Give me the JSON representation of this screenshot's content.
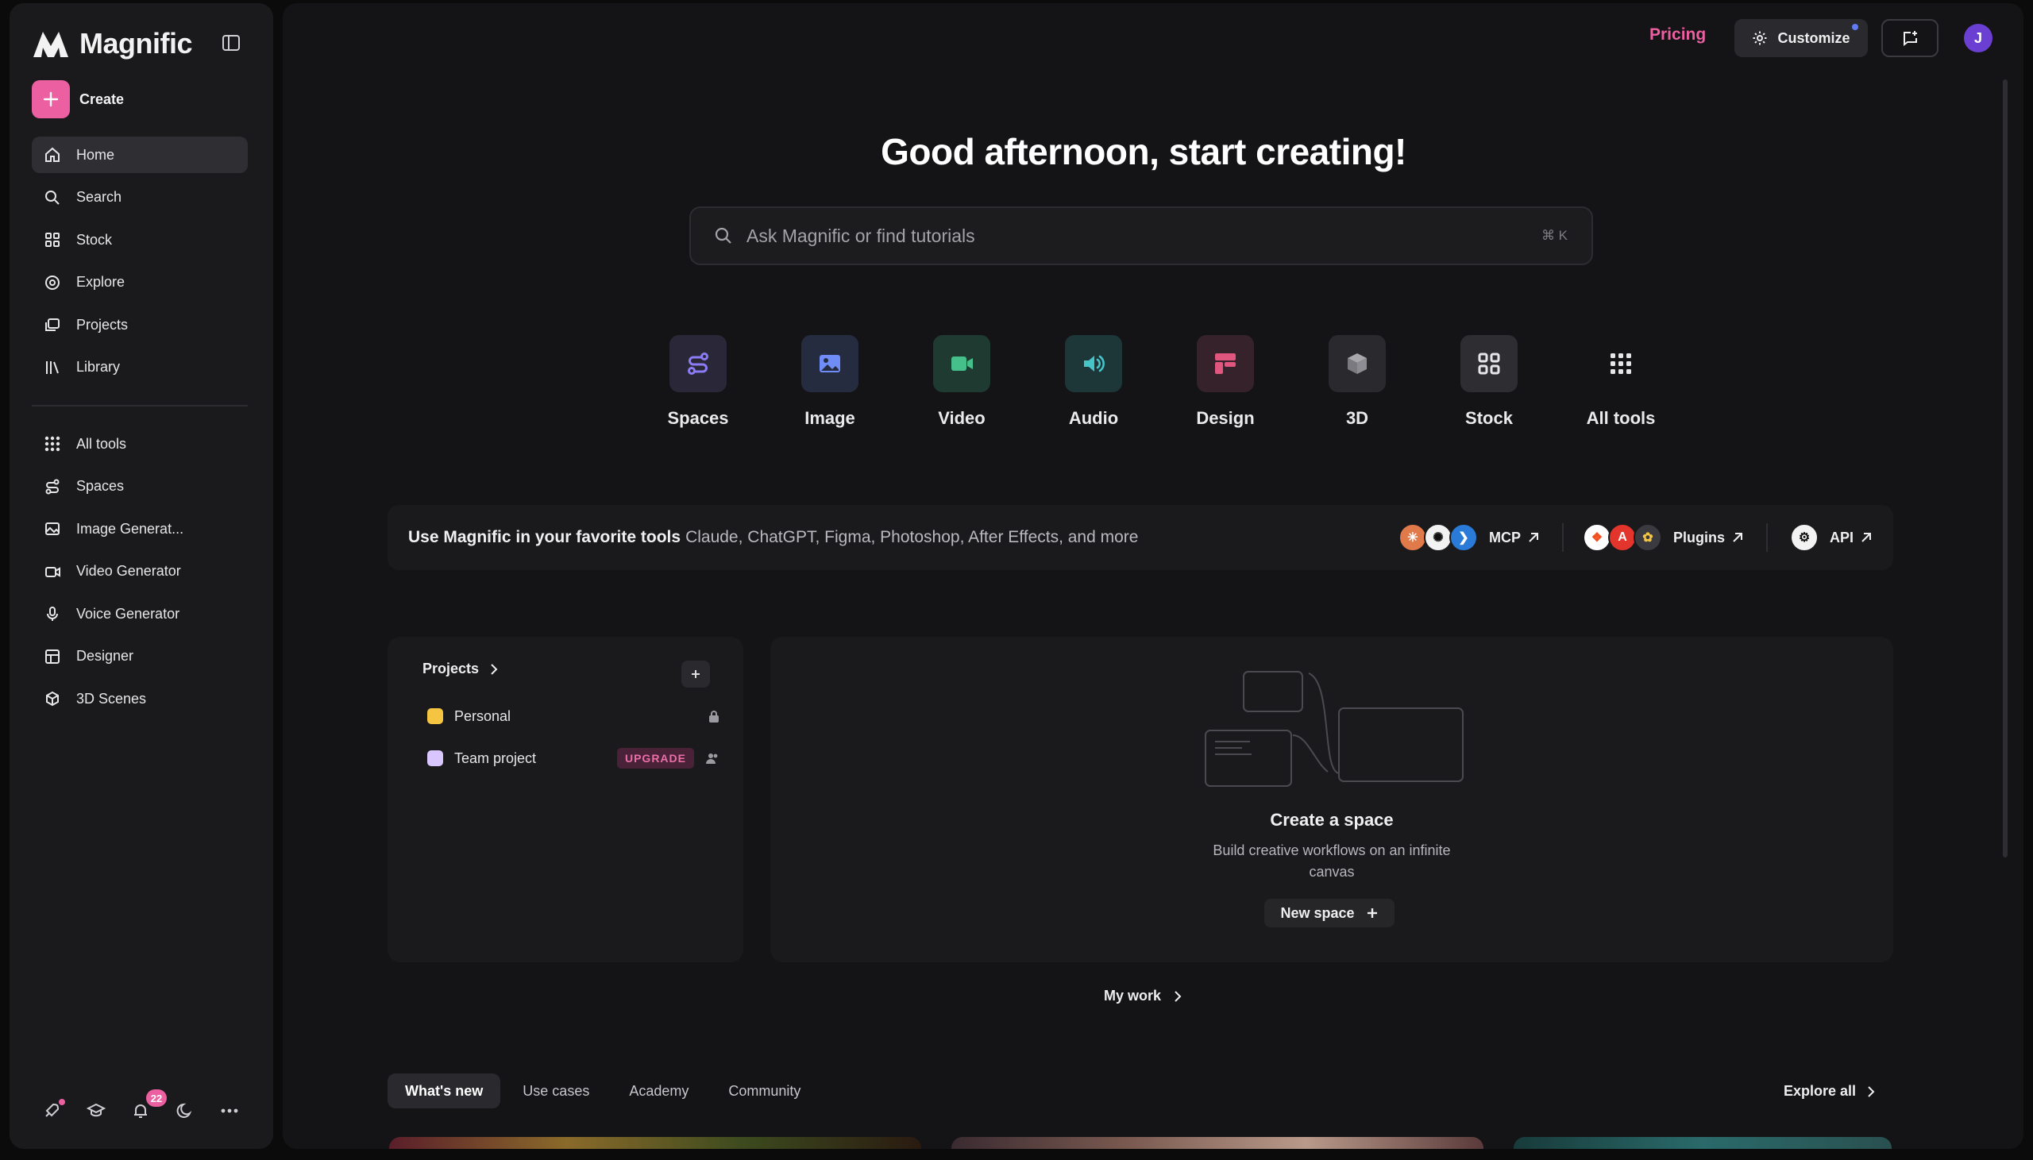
{
  "brand": {
    "name": "Magnific"
  },
  "sidebar": {
    "create_label": "Create",
    "primary": [
      {
        "label": "Home",
        "icon": "home-icon",
        "active": true
      },
      {
        "label": "Search",
        "icon": "search-icon"
      },
      {
        "label": "Stock",
        "icon": "stock-icon"
      },
      {
        "label": "Explore",
        "icon": "explore-icon"
      },
      {
        "label": "Projects",
        "icon": "projects-icon"
      },
      {
        "label": "Library",
        "icon": "library-icon"
      }
    ],
    "secondary": [
      {
        "label": "All tools",
        "icon": "grid-icon"
      },
      {
        "label": "Spaces",
        "icon": "spaces-icon"
      },
      {
        "label": "Image Generat...",
        "icon": "image-icon"
      },
      {
        "label": "Video Generator",
        "icon": "video-icon"
      },
      {
        "label": "Voice Generator",
        "icon": "microphone-icon"
      },
      {
        "label": "Designer",
        "icon": "designer-icon"
      },
      {
        "label": "3D Scenes",
        "icon": "3d-icon"
      }
    ],
    "notifications_count": "22"
  },
  "topbar": {
    "pricing_label": "Pricing",
    "customize_label": "Customize",
    "avatar_initial": "J"
  },
  "main": {
    "greeting": "Good afternoon, start creating!",
    "search": {
      "placeholder": "Ask Magnific or find tutorials",
      "shortcut": "⌘ K"
    },
    "tools": [
      {
        "label": "Spaces",
        "icon": "spaces-icon",
        "color": "#8b7cf6"
      },
      {
        "label": "Image",
        "icon": "image-icon",
        "color": "#6f8cf7"
      },
      {
        "label": "Video",
        "icon": "video-icon",
        "color": "#46c08b"
      },
      {
        "label": "Audio",
        "icon": "audio-icon",
        "color": "#46c4c8"
      },
      {
        "label": "Design",
        "icon": "design-icon",
        "color": "#e0567e"
      },
      {
        "label": "3D",
        "icon": "cube-icon",
        "color": "#8a8a90"
      },
      {
        "label": "Stock",
        "icon": "stock-icon",
        "color": "#e6e6e8"
      },
      {
        "label": "All tools",
        "icon": "grid-icon",
        "color": "#e6e6e8"
      }
    ],
    "integrations": {
      "title": "Use Magnific in your favorite tools",
      "subtitle": "Claude, ChatGPT, Figma, Photoshop, After Effects, and more",
      "mcp_label": "MCP",
      "plugins_label": "Plugins",
      "api_label": "API"
    },
    "projects": {
      "heading": "Projects",
      "items": [
        {
          "name": "Personal",
          "color": "#f5c542"
        },
        {
          "name": "Team project",
          "color": "#d9c6ff",
          "badge": "UPGRADE"
        }
      ]
    },
    "space": {
      "title": "Create a space",
      "description": "Build creative workflows on an infinite canvas",
      "button_label": "New space"
    },
    "my_work_label": "My work",
    "tabs": [
      "What's new",
      "Use cases",
      "Academy",
      "Community"
    ],
    "explore_all_label": "Explore all"
  }
}
